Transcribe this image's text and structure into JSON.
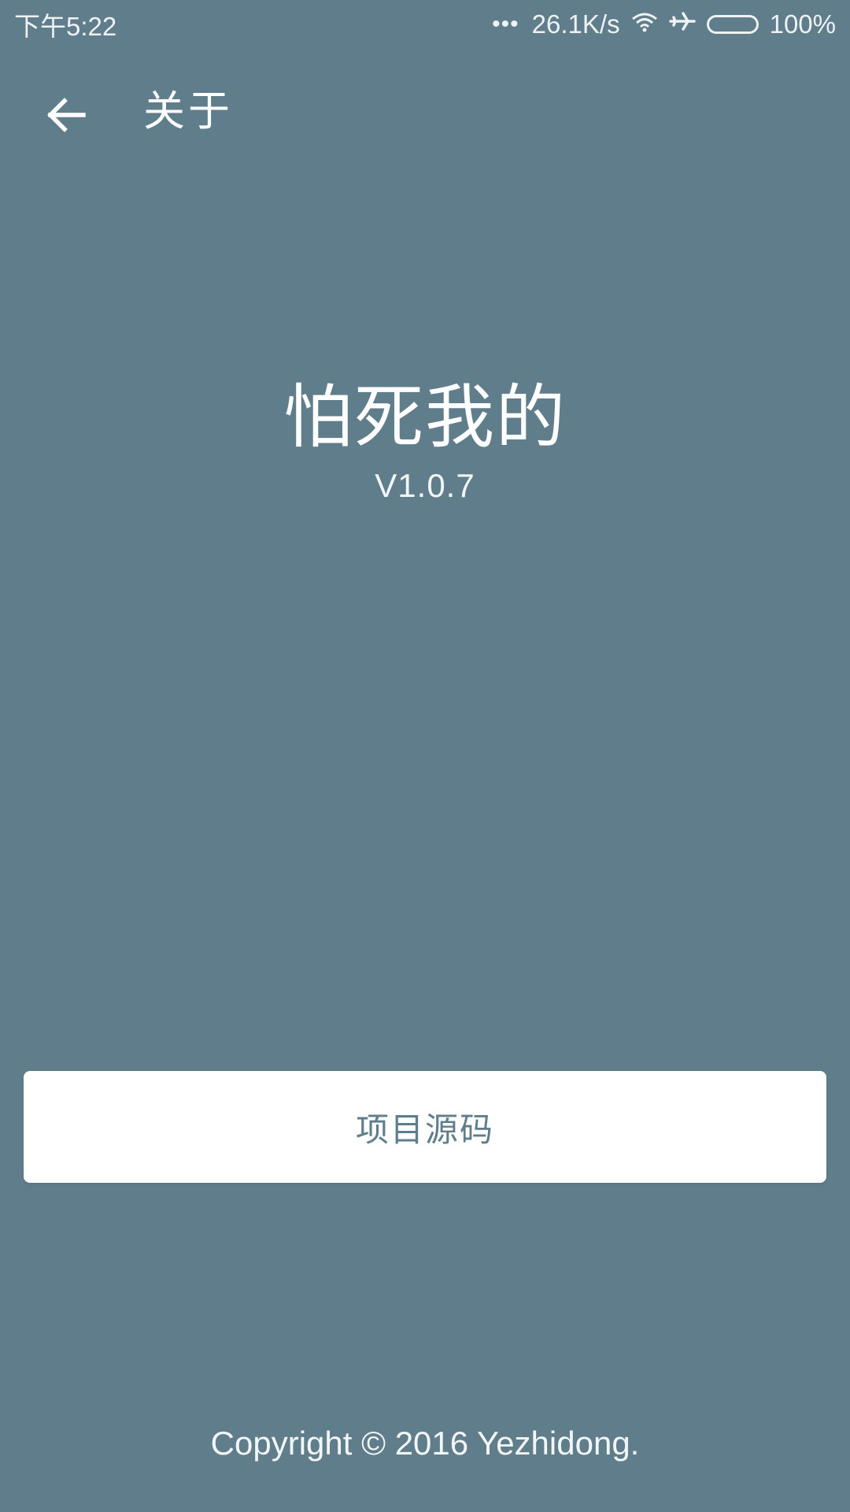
{
  "status_bar": {
    "time": "下午5:22",
    "network_speed": "26.1K/s",
    "battery_percent": "100%",
    "icons": [
      "more-dots-icon",
      "wifi-icon",
      "airplane-mode-icon",
      "battery-icon"
    ]
  },
  "toolbar": {
    "title": "关于",
    "back_icon": "arrow-left-icon"
  },
  "app": {
    "name": "怕死我的",
    "version": "V1.0.7"
  },
  "actions": {
    "source_label": "项目源码"
  },
  "footer": {
    "copyright": "Copyright © 2016 Yezhidong."
  },
  "colors": {
    "background": "#607d8b",
    "button_background": "#ffffff",
    "button_text": "#607d8b",
    "text": "#ffffff"
  }
}
